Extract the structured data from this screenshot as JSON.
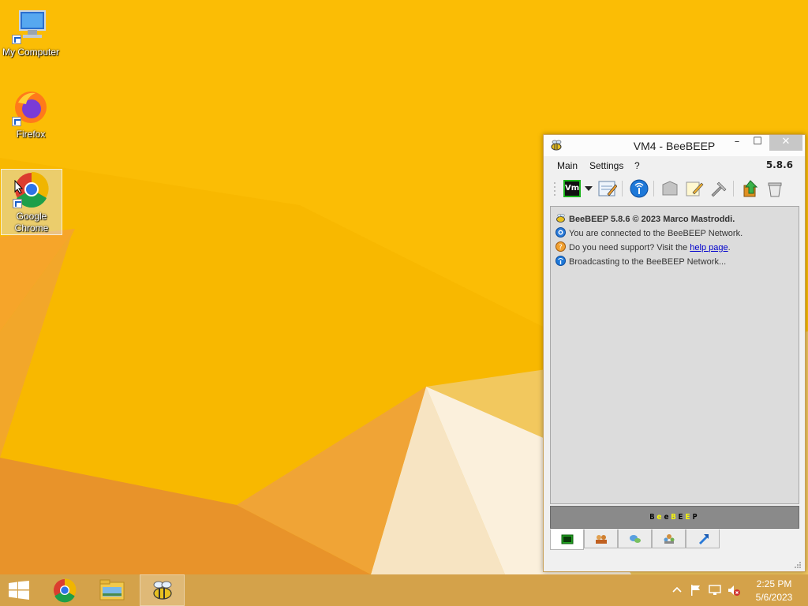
{
  "desktop": {
    "icons": [
      {
        "label": "My Computer"
      },
      {
        "label": "Firefox"
      },
      {
        "label_line1": "Google",
        "label_line2": "Chrome"
      }
    ]
  },
  "window": {
    "title": "VM4 - BeeBEEP",
    "controls": {
      "minimize": "–",
      "maximize": "☐",
      "close": "✕"
    },
    "menu": [
      "Main",
      "Settings",
      "?"
    ],
    "version": "5.8.6",
    "toolbar": {
      "status_badge": "Vm"
    },
    "log": [
      {
        "text": "BeeBEEP 5.8.6 © 2023 Marco Mastroddi."
      },
      {
        "text": "You are connected to the BeeBEEP Network."
      },
      {
        "text_before": "Do you need support? Visit the ",
        "link": "help page",
        "text_after": "."
      },
      {
        "text": "Broadcasting to the BeeBEEP Network..."
      }
    ],
    "banner": {
      "letters": [
        "B",
        "e",
        "e",
        "B",
        "E",
        "E",
        "P"
      ],
      "colors": [
        "#000000",
        "#ffff00",
        "#000000",
        "#ffff00",
        "#000000",
        "#ffff00",
        "#000000"
      ]
    }
  },
  "taskbar": {
    "time": "2:25 PM",
    "date": "5/6/2023"
  },
  "colors": {
    "wallpaper": "#f7b500",
    "taskbar": "#d4a24a"
  }
}
